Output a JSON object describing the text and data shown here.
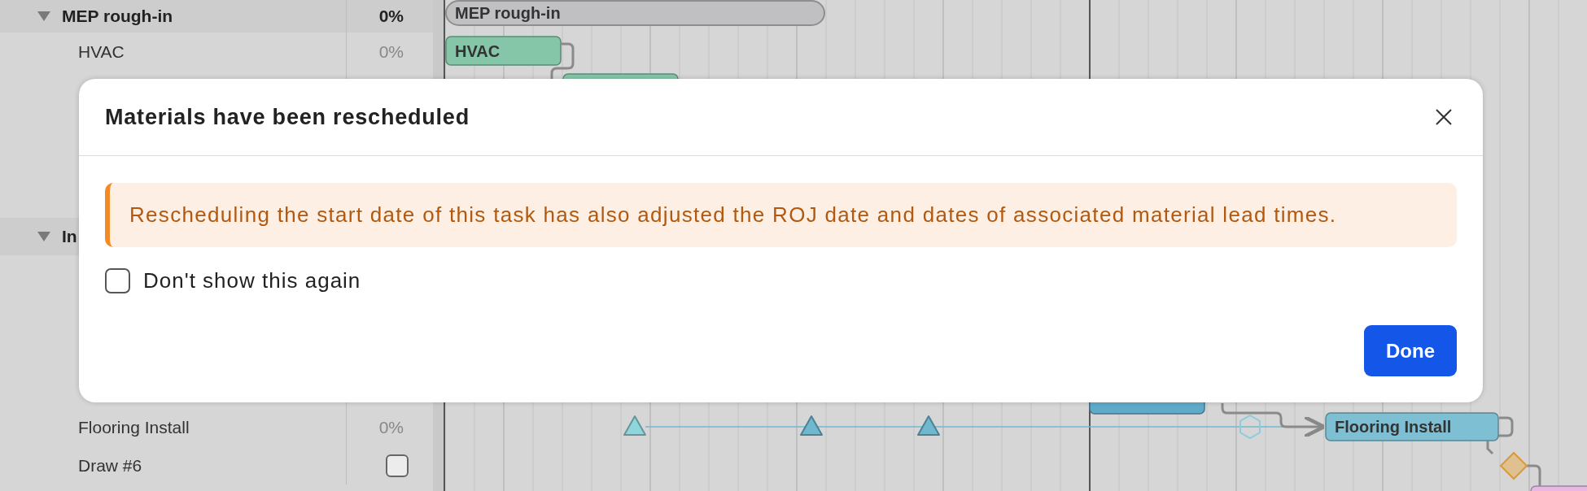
{
  "task_list": {
    "rows": [
      {
        "kind": "group",
        "name": "MEP rough-in",
        "progress": "0%",
        "expanded": true
      },
      {
        "kind": "task",
        "name": "HVAC",
        "progress": "0%"
      },
      {
        "kind": "group",
        "name": "In",
        "expanded": true
      },
      {
        "kind": "task",
        "name": "Flooring Install",
        "progress": "0%"
      },
      {
        "kind": "draw",
        "name": "Draw #6",
        "checked": false
      }
    ]
  },
  "gantt": {
    "bars": [
      {
        "kind": "summary",
        "label": "MEP rough-in"
      },
      {
        "kind": "task",
        "label": "HVAC",
        "color": "#86c6a8"
      },
      {
        "kind": "task",
        "color": "#86c6a8"
      },
      {
        "kind": "task",
        "color": "#5fa9c9"
      },
      {
        "kind": "task",
        "label": "Flooring Install",
        "color": "#7fbfd3"
      },
      {
        "kind": "task",
        "color": "#e9b7e6"
      }
    ],
    "milestones": [
      {
        "kind": "triangle",
        "color": "#8fd6dc"
      },
      {
        "kind": "triangle",
        "color": "#6fb8d0"
      },
      {
        "kind": "triangle",
        "color": "#6fb8d0"
      },
      {
        "kind": "hexagon",
        "color": "#8ccbe0"
      },
      {
        "kind": "diamond",
        "color": "#dfc08f"
      }
    ]
  },
  "dialog": {
    "title": "Materials have been rescheduled",
    "message": "Rescheduling the start date of this task has also adjusted the ROJ date and dates of associated material lead times.",
    "checkbox": {
      "label": "Don't show this again",
      "checked": false
    },
    "button": "Done"
  }
}
